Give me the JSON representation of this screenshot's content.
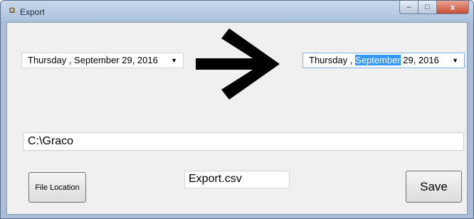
{
  "window": {
    "title": "Export",
    "app_icon": "Ω",
    "caption_buttons": {
      "minimize": "–",
      "maximize": "□",
      "close": "x"
    }
  },
  "date_from": {
    "weekday": "Thursday",
    "separator": " , ",
    "month": "September",
    "day_year": " 29, 2016"
  },
  "date_to": {
    "weekday": "Thursday",
    "separator": " , ",
    "month": "September",
    "day_year": " 29, 2016"
  },
  "dropdown_glyph": "▼",
  "icons": {
    "arrow": "right-arrow-icon"
  },
  "path_field": {
    "value": "C:\\Graco"
  },
  "filename_field": {
    "value": "Export.csv"
  },
  "buttons": {
    "file_location": "File Location",
    "save": "Save"
  },
  "colors": {
    "selection": "#3399ff",
    "client_bg": "#f0f0f0",
    "close_button": "#c74d35"
  }
}
